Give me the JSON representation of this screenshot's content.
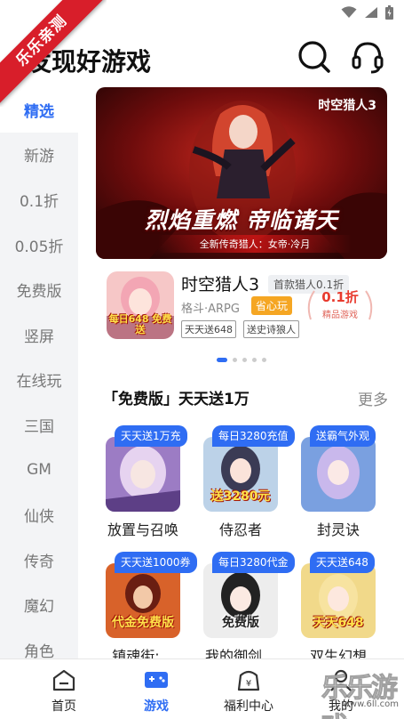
{
  "ribbon": {
    "text": "乐乐亲测"
  },
  "header": {
    "title": "发现好游戏",
    "search_icon": "search-icon",
    "service_icon": "headset-icon"
  },
  "sidenav": {
    "items": [
      {
        "label": "精选",
        "active": true
      },
      {
        "label": "新游"
      },
      {
        "label": "0.1折"
      },
      {
        "label": "0.05折"
      },
      {
        "label": "免费版"
      },
      {
        "label": "竖屏"
      },
      {
        "label": "在线玩"
      },
      {
        "label": "三国"
      },
      {
        "label": "GM"
      },
      {
        "label": "仙侠"
      },
      {
        "label": "传奇"
      },
      {
        "label": "魔幻"
      },
      {
        "label": "角色"
      }
    ]
  },
  "banner": {
    "logo": "时空猎人3",
    "slogan": "烈焰重燃 帝临诸天",
    "sub": "全新传奇猎人：女帝·冷月"
  },
  "featured": {
    "name": "时空猎人3",
    "tag": "首款猎人0.1折",
    "genre": "格斗·ARPG",
    "badge": "省心玩",
    "chips": [
      "天天送648",
      "送史诗狼人"
    ],
    "icon_text": "每日648 免费送",
    "seal_rate": "0.1折",
    "seal_text": "精品游戏"
  },
  "carousel": {
    "count": 5,
    "active_index": 0
  },
  "section": {
    "title": "「免费版」天天送1万",
    "more": "更多",
    "games": [
      {
        "tag": "天天送1万充",
        "name": "放置与召唤",
        "art": ""
      },
      {
        "tag": "每日3280充值",
        "name": "侍忍者",
        "art": "送3280元"
      },
      {
        "tag": "送霸气外观",
        "name": "封灵诀",
        "art": ""
      },
      {
        "tag": "天天送1000券",
        "name": "镇魂街:…",
        "art": "代金免费版"
      },
      {
        "tag": "每日3280代金",
        "name": "我的御剑…",
        "art": "免费版"
      },
      {
        "tag": "天天送648",
        "name": "双生幻想",
        "art": "天天648"
      }
    ]
  },
  "tabbar": {
    "items": [
      {
        "label": "首页",
        "icon": "home-icon"
      },
      {
        "label": "游戏",
        "icon": "gamepad-icon",
        "active": true
      },
      {
        "label": "福利中心",
        "icon": "gift-icon"
      },
      {
        "label": "我的",
        "icon": "user-icon"
      }
    ]
  },
  "watermark": {
    "text": "乐乐游戏",
    "url": "www.6ll.com"
  },
  "colors": {
    "accent": "#2f6df3",
    "ribbon": "#d81e2a",
    "badge": "#f5a623",
    "seal": "#e83a2e"
  }
}
